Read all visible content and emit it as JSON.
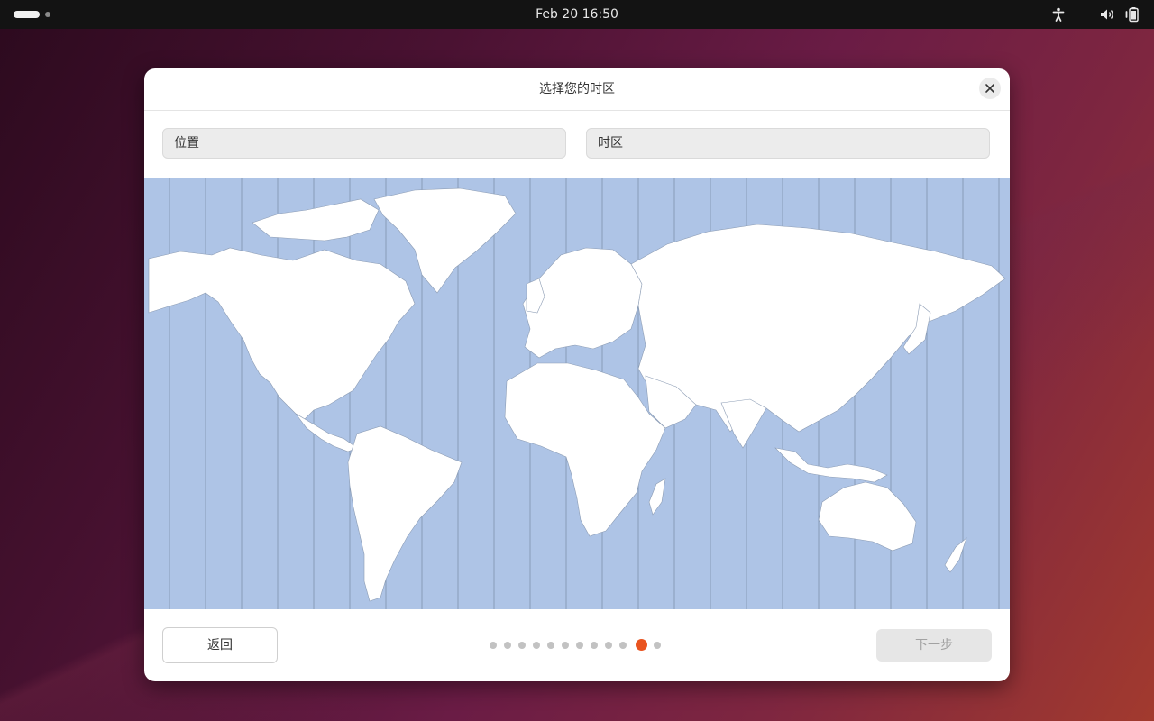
{
  "topbar": {
    "clock": "Feb 20  16:50",
    "icons": [
      "accessibility-icon",
      "volume-icon",
      "battery-icon"
    ]
  },
  "dialog": {
    "title": "选择您的时区",
    "location_placeholder": "位置",
    "timezone_placeholder": "时区",
    "back_label": "返回",
    "next_label": "下一步",
    "pager": {
      "total": 12,
      "active_index": 10
    }
  },
  "colors": {
    "accent": "#e95420",
    "map_water": "#aec4e6",
    "map_land": "#ffffff",
    "topbar": "#131313"
  }
}
